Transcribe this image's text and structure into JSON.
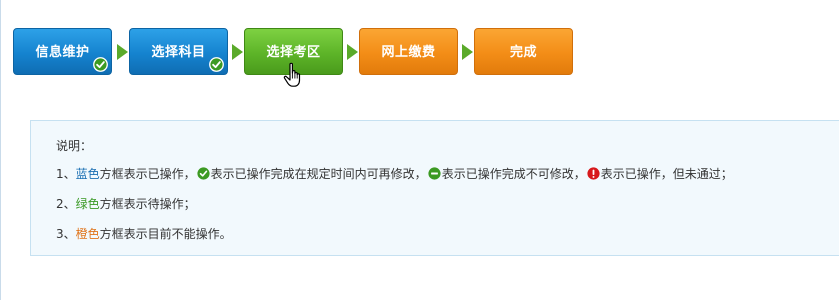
{
  "steps": [
    {
      "label": "信息维护",
      "state": "blue",
      "completed": true
    },
    {
      "label": "选择科目",
      "state": "blue",
      "completed": true
    },
    {
      "label": "选择考区",
      "state": "green",
      "completed": false
    },
    {
      "label": "网上缴费",
      "state": "orange",
      "completed": false
    },
    {
      "label": "完成",
      "state": "orange",
      "completed": false
    }
  ],
  "info": {
    "title": "说明：",
    "line1": {
      "num": "1、",
      "color_word": "蓝色",
      "part1": "方框表示已操作，",
      "part2": "表示已操作完成在规定时间内可再修改，",
      "part3": "表示已操作完成不可修改，",
      "part4": "表示已操作，但未通过；"
    },
    "line2": {
      "num": "2、",
      "color_word": "绿色",
      "rest": "方框表示待操作；"
    },
    "line3": {
      "num": "3、",
      "color_word": "橙色",
      "rest": "方框表示目前不能操作。"
    }
  },
  "colors": {
    "blue": "#1583cf",
    "green": "#5db428",
    "orange": "#f38d17",
    "arrow": "#5aaa2a",
    "info_bg": "#f2f9fd",
    "info_border": "#c6e1f1"
  },
  "icons": {
    "completed_editable": "green-check-icon",
    "completed_locked": "green-minus-icon",
    "failed": "red-exclamation-icon",
    "cursor": "hand-pointer-icon",
    "connector": "arrow-right-icon"
  }
}
